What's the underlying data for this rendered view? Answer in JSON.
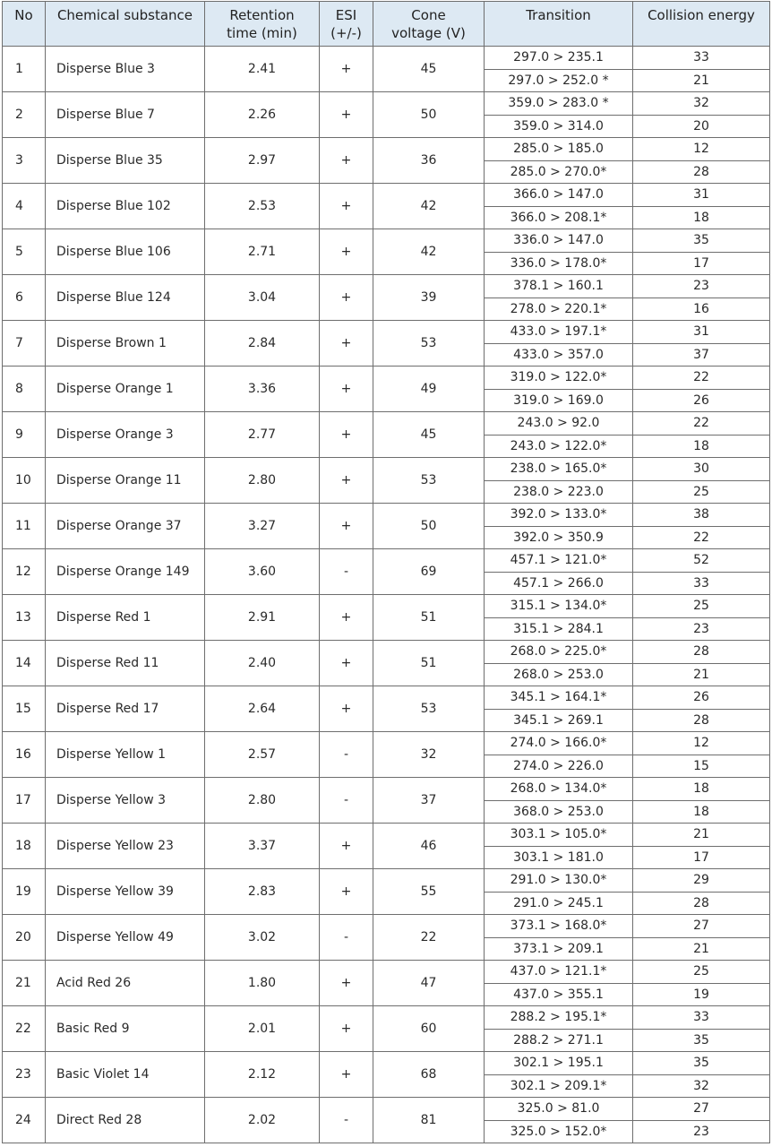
{
  "table": {
    "headers": {
      "no": "No",
      "substance": "Chemical substance",
      "retention_line1": "Retention",
      "retention_line2": "time (min)",
      "esi_line1": "ESI",
      "esi_line2": "(+/-)",
      "cone_line1": "Cone",
      "cone_line2": "voltage (V)",
      "transition": "Transition",
      "collision": "Collision energy"
    },
    "rows": [
      {
        "no": "1",
        "substance": "Disperse Blue 3",
        "retention": "2.41",
        "esi": "+",
        "cone": "45",
        "transitions": [
          {
            "transition": "297.0 > 235.1",
            "collision": "33"
          },
          {
            "transition": "297.0 > 252.0 *",
            "collision": "21"
          }
        ]
      },
      {
        "no": "2",
        "substance": "Disperse Blue 7",
        "retention": "2.26",
        "esi": "+",
        "cone": "50",
        "transitions": [
          {
            "transition": "359.0 > 283.0 *",
            "collision": "32"
          },
          {
            "transition": "359.0 > 314.0",
            "collision": "20"
          }
        ]
      },
      {
        "no": "3",
        "substance": "Disperse Blue 35",
        "retention": "2.97",
        "esi": "+",
        "cone": "36",
        "transitions": [
          {
            "transition": "285.0 > 185.0",
            "collision": "12"
          },
          {
            "transition": "285.0 > 270.0*",
            "collision": "28"
          }
        ]
      },
      {
        "no": "4",
        "substance": "Disperse Blue 102",
        "retention": "2.53",
        "esi": "+",
        "cone": "42",
        "transitions": [
          {
            "transition": "366.0 > 147.0",
            "collision": "31"
          },
          {
            "transition": "366.0 > 208.1*",
            "collision": "18"
          }
        ]
      },
      {
        "no": "5",
        "substance": "Disperse Blue 106",
        "retention": "2.71",
        "esi": "+",
        "cone": "42",
        "transitions": [
          {
            "transition": "336.0 > 147.0",
            "collision": "35"
          },
          {
            "transition": "336.0 > 178.0*",
            "collision": "17"
          }
        ]
      },
      {
        "no": "6",
        "substance": "Disperse Blue 124",
        "retention": "3.04",
        "esi": "+",
        "cone": "39",
        "transitions": [
          {
            "transition": "378.1 > 160.1",
            "collision": "23"
          },
          {
            "transition": "278.0 > 220.1*",
            "collision": "16"
          }
        ]
      },
      {
        "no": "7",
        "substance": "Disperse Brown 1",
        "retention": "2.84",
        "esi": "+",
        "cone": "53",
        "transitions": [
          {
            "transition": "433.0 > 197.1*",
            "collision": "31"
          },
          {
            "transition": "433.0 > 357.0",
            "collision": "37"
          }
        ]
      },
      {
        "no": "8",
        "substance": "Disperse Orange 1",
        "retention": "3.36",
        "esi": "+",
        "cone": "49",
        "transitions": [
          {
            "transition": "319.0 > 122.0*",
            "collision": "22"
          },
          {
            "transition": "319.0 > 169.0",
            "collision": "26"
          }
        ]
      },
      {
        "no": "9",
        "substance": "Disperse Orange 3",
        "retention": "2.77",
        "esi": "+",
        "cone": "45",
        "transitions": [
          {
            "transition": "243.0 > 92.0",
            "collision": "22"
          },
          {
            "transition": "243.0 > 122.0*",
            "collision": "18"
          }
        ]
      },
      {
        "no": "10",
        "substance": "Disperse Orange 11",
        "retention": "2.80",
        "esi": "+",
        "cone": "53",
        "transitions": [
          {
            "transition": "238.0 > 165.0*",
            "collision": "30"
          },
          {
            "transition": "238.0 > 223.0",
            "collision": "25"
          }
        ]
      },
      {
        "no": "11",
        "substance": "Disperse Orange 37",
        "retention": "3.27",
        "esi": "+",
        "cone": "50",
        "transitions": [
          {
            "transition": "392.0 > 133.0*",
            "collision": "38"
          },
          {
            "transition": "392.0 > 350.9",
            "collision": "22"
          }
        ]
      },
      {
        "no": "12",
        "substance": "Disperse Orange 149",
        "retention": "3.60",
        "esi": "-",
        "cone": "69",
        "transitions": [
          {
            "transition": "457.1 > 121.0*",
            "collision": "52"
          },
          {
            "transition": "457.1 > 266.0",
            "collision": "33"
          }
        ]
      },
      {
        "no": "13",
        "substance": "Disperse Red 1",
        "retention": "2.91",
        "esi": "+",
        "cone": "51",
        "transitions": [
          {
            "transition": "315.1 > 134.0*",
            "collision": "25"
          },
          {
            "transition": "315.1 > 284.1",
            "collision": "23"
          }
        ]
      },
      {
        "no": "14",
        "substance": "Disperse Red 11",
        "retention": "2.40",
        "esi": "+",
        "cone": "51",
        "transitions": [
          {
            "transition": "268.0 > 225.0*",
            "collision": "28"
          },
          {
            "transition": "268.0 > 253.0",
            "collision": "21"
          }
        ]
      },
      {
        "no": "15",
        "substance": "Disperse Red 17",
        "retention": "2.64",
        "esi": "+",
        "cone": "53",
        "transitions": [
          {
            "transition": "345.1 > 164.1*",
            "collision": "26"
          },
          {
            "transition": "345.1 > 269.1",
            "collision": "28"
          }
        ]
      },
      {
        "no": "16",
        "substance": "Disperse Yellow 1",
        "retention": "2.57",
        "esi": "-",
        "cone": "32",
        "transitions": [
          {
            "transition": "274.0 > 166.0*",
            "collision": "12"
          },
          {
            "transition": "274.0 > 226.0",
            "collision": "15"
          }
        ]
      },
      {
        "no": "17",
        "substance": "Disperse Yellow 3",
        "retention": "2.80",
        "esi": "-",
        "cone": "37",
        "transitions": [
          {
            "transition": "268.0 > 134.0*",
            "collision": "18"
          },
          {
            "transition": "368.0 > 253.0",
            "collision": "18"
          }
        ]
      },
      {
        "no": "18",
        "substance": "Disperse Yellow 23",
        "retention": "3.37",
        "esi": "+",
        "cone": "46",
        "transitions": [
          {
            "transition": "303.1 > 105.0*",
            "collision": "21"
          },
          {
            "transition": "303.1 > 181.0",
            "collision": "17"
          }
        ]
      },
      {
        "no": "19",
        "substance": "Disperse Yellow 39",
        "retention": "2.83",
        "esi": "+",
        "cone": "55",
        "transitions": [
          {
            "transition": "291.0 > 130.0*",
            "collision": "29"
          },
          {
            "transition": "291.0 > 245.1",
            "collision": "28"
          }
        ]
      },
      {
        "no": "20",
        "substance": "Disperse Yellow 49",
        "retention": "3.02",
        "esi": "-",
        "cone": "22",
        "transitions": [
          {
            "transition": "373.1 > 168.0*",
            "collision": "27"
          },
          {
            "transition": "373.1 > 209.1",
            "collision": "21"
          }
        ]
      },
      {
        "no": "21",
        "substance": "Acid Red 26",
        "retention": "1.80",
        "esi": "+",
        "cone": "47",
        "transitions": [
          {
            "transition": "437.0 > 121.1*",
            "collision": "25"
          },
          {
            "transition": "437.0 > 355.1",
            "collision": "19"
          }
        ]
      },
      {
        "no": "22",
        "substance": "Basic Red 9",
        "retention": "2.01",
        "esi": "+",
        "cone": "60",
        "transitions": [
          {
            "transition": "288.2 > 195.1*",
            "collision": "33"
          },
          {
            "transition": "288.2 > 271.1",
            "collision": "35"
          }
        ]
      },
      {
        "no": "23",
        "substance": "Basic Violet 14",
        "retention": "2.12",
        "esi": "+",
        "cone": "68",
        "transitions": [
          {
            "transition": "302.1 > 195.1",
            "collision": "35"
          },
          {
            "transition": "302.1 > 209.1*",
            "collision": "32"
          }
        ]
      },
      {
        "no": "24",
        "substance": "Direct Red 28",
        "retention": "2.02",
        "esi": "-",
        "cone": "81",
        "transitions": [
          {
            "transition": "325.0 > 81.0",
            "collision": "27"
          },
          {
            "transition": "325.0 > 152.0*",
            "collision": "23"
          }
        ]
      }
    ]
  },
  "colors": {
    "header_background": "#dde9f3",
    "border": "#6e6e6e",
    "text": "#2a2a2a"
  }
}
